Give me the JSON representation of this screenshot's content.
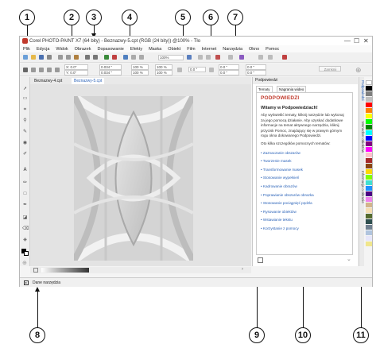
{
  "window": {
    "title": "Corel PHOTO-PAINT X7 (64 bity) - Beznazwy-5.cpt (RGB (24 bity)) @100% - Tło",
    "minimize": "—",
    "maximize": "☐",
    "close": "✕"
  },
  "menu": [
    "Plik",
    "Edycja",
    "Widok",
    "Obrazek",
    "Dopasowanie",
    "Efekty",
    "Maska",
    "Obiekt",
    "Film",
    "Internet",
    "Narzędzia",
    "Okno",
    "Pomoc"
  ],
  "toolbar": {
    "zoom": "100%",
    "launch_label": "Zamknij"
  },
  "property_bar": {
    "x": "X: 0.0\"",
    "y": "Y: 0.0\"",
    "w1": "0.034 \"",
    "h1": "0.034 \"",
    "p1": "100 %",
    "p2": "100 %",
    "angle": "0.0 °",
    "f1": "0.0 \"",
    "f2": "0.0 \"",
    "f3": "0.0 \"",
    "f4": "0.0 \""
  },
  "tabs": [
    "Beznazwy-4.cpt",
    "Beznazwy-5.cpt"
  ],
  "docker": {
    "header": "Podpowiedzi",
    "tabs": [
      "Tematy",
      "Nagrania wideo"
    ],
    "title": "PODPOWIEDZI",
    "welcome": "Witamy w Podpowiedziach!",
    "intro": "Aby wyświetlić tematy, kliknij narzędzie lub wykonaj za jego pomocą działanie. Aby uzyskać dodatkowe informacje na temat aktywnego narzędzia, kliknij przycisk Pomoc, znajdujący się w prawym górnym rogu okna dokowanego Podpowiedzi.",
    "list_intro": "Oto kilka szczegółów pomocnych tematów:",
    "links": [
      "• Zaznaczanie obszarów",
      "• Tworzenie masek",
      "• Transformowanie masek",
      "• Stosowanie wypełnień",
      "• Kadrowanie obrazów",
      "• Poprawianie obszarów obrazka",
      "• Stosowanie pociągnięć pędzla",
      "• Rysowanie obiektów",
      "• Wstawianie tekstu",
      "• Korzystanie z pomocy"
    ]
  },
  "side_tabs": [
    "Podpowiedzi",
    "Menedżer obiektów",
    "Informacje o obrazie"
  ],
  "status": "Dane narzędzia",
  "callouts": [
    "1",
    "2",
    "3",
    "4",
    "5",
    "6",
    "7",
    "8",
    "9",
    "10",
    "11"
  ],
  "palette_colors": [
    "#ffffff",
    "#000000",
    "#7f7f7f",
    "#c0c0c0",
    "#ff0000",
    "#ff7f00",
    "#ffff00",
    "#00ff00",
    "#008000",
    "#00ffff",
    "#0000ff",
    "#800080",
    "#ff00ff",
    "#ffc0cb",
    "#a52a2a",
    "#8b4513",
    "#ffd700",
    "#7fff00",
    "#40e0d0",
    "#1e90ff",
    "#4b0082",
    "#ee82ee",
    "#d2b48c",
    "#f5deb3",
    "#556b2f",
    "#2f4f4f",
    "#708090",
    "#b0c4de",
    "#e6e6fa",
    "#f0e68c"
  ],
  "colors": {
    "accent": "#2a62b8",
    "hint_title": "#c0392b"
  }
}
